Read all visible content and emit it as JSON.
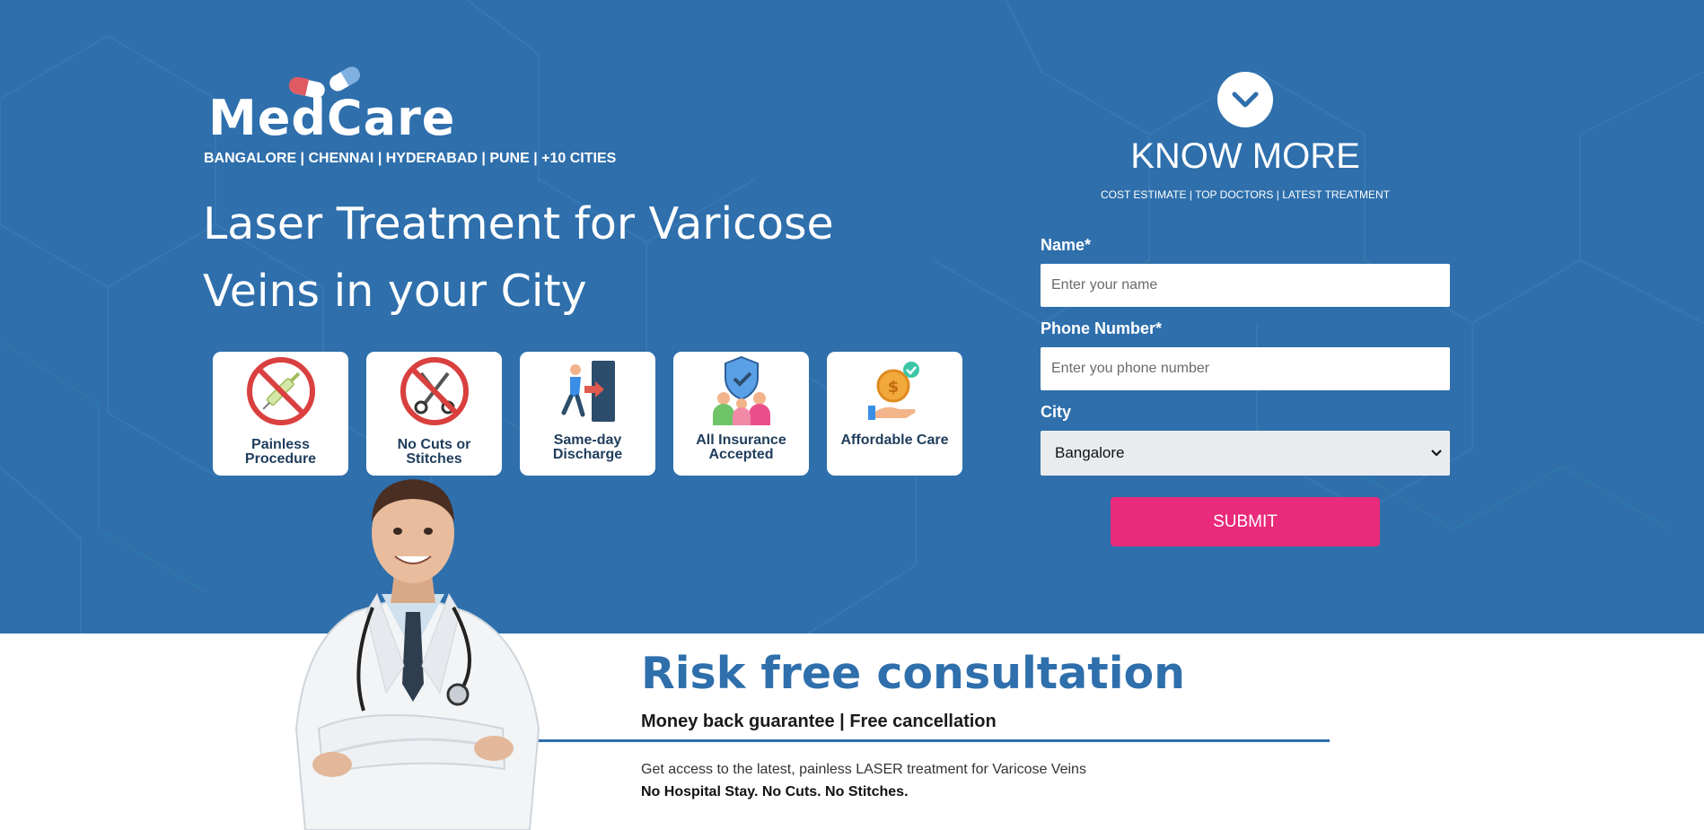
{
  "brand": {
    "name": "MedCare",
    "cities": "BANGALORE | CHENNAI | HYDERABAD | PUNE | +10 CITIES"
  },
  "hero": {
    "headline_line1": "Laser Treatment for Varicose",
    "headline_line2": "Veins in your City"
  },
  "features": [
    {
      "line1": "Painless",
      "line2": "Procedure",
      "icon": "no-injection-icon"
    },
    {
      "line1": "No Cuts or",
      "line2": "Stitches",
      "icon": "no-scissors-icon"
    },
    {
      "line1": "Same-day",
      "line2": "Discharge",
      "icon": "exit-door-icon"
    },
    {
      "line1": "All Insurance",
      "line2": "Accepted",
      "icon": "insurance-shield-icon"
    },
    {
      "line1": "Affordable Care",
      "line2": "",
      "icon": "coin-hand-icon"
    }
  ],
  "form": {
    "title": "KNOW MORE",
    "subtitle": "COST ESTIMATE | TOP DOCTORS | LATEST TREATMENT",
    "name_label": "Name*",
    "name_placeholder": "Enter your name",
    "phone_label": "Phone Number*",
    "phone_placeholder": "Enter you phone number",
    "city_label": "City",
    "city_value": "Bangalore",
    "submit_label": "SUBMIT"
  },
  "consult": {
    "title": "Risk free consultation",
    "subtitle": "Money back guarantee | Free cancellation",
    "text": "Get access to the latest, painless LASER treatment for Varicose Veins",
    "emphasis": "No Hospital Stay. No Cuts. No Stitches."
  },
  "colors": {
    "hero_bg": "#2e6fac",
    "accent_pink": "#ea2a7a",
    "title_blue": "#2e6fac"
  }
}
